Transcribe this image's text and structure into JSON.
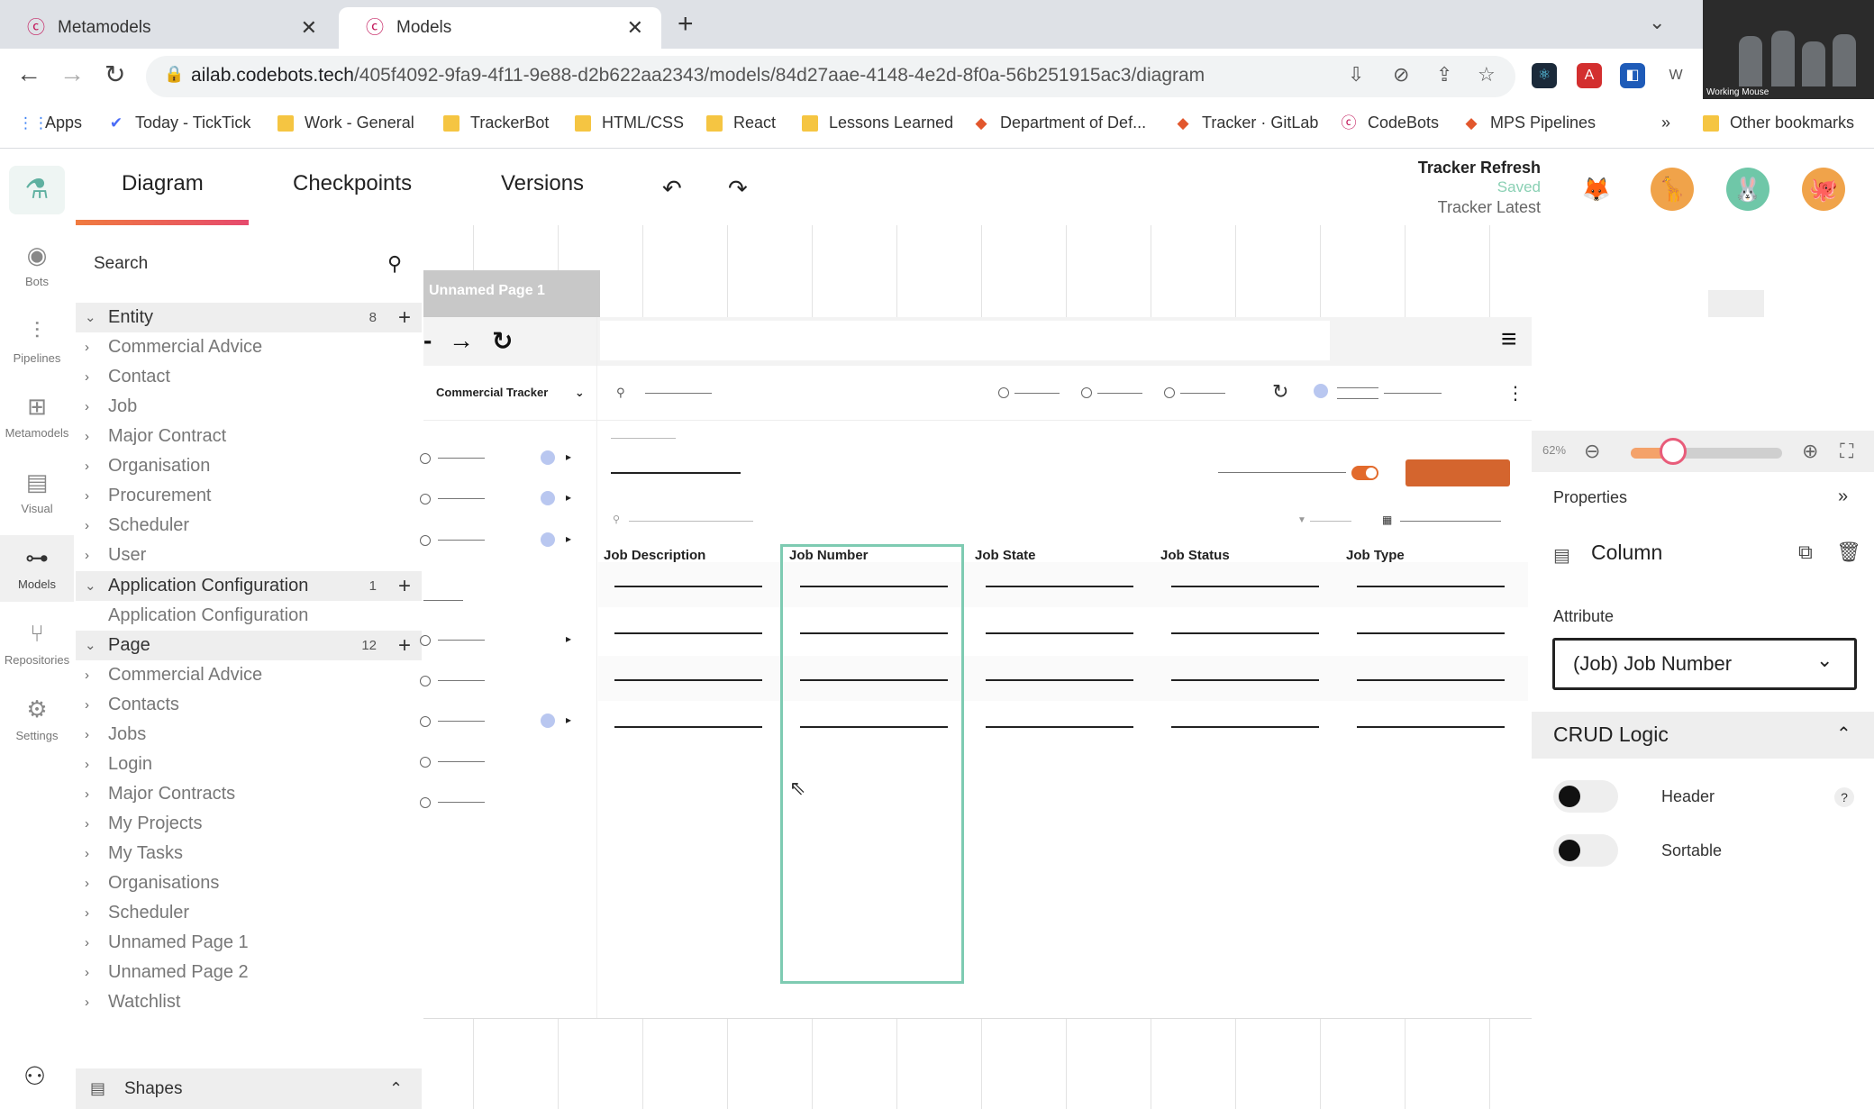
{
  "browser": {
    "tabs": [
      {
        "title": "Metamodels",
        "active": false
      },
      {
        "title": "Models",
        "active": true
      }
    ],
    "url_host": "ailab.codebots.tech",
    "url_path": "/405f4092-9fa9-4f11-9e88-d2b622aa2343/models/84d27aae-4148-4e2d-8f0a-56b251915ac3/diagram",
    "bookmarks": [
      "Apps",
      "Today - TickTick",
      "Work - General",
      "TrackerBot",
      "HTML/CSS",
      "React",
      "Lessons Learned",
      "Department of Def...",
      "Tracker · GitLab",
      "CodeBots",
      "MPS Pipelines"
    ],
    "other_bookmarks": "Other bookmarks",
    "video_label": "Working Mouse"
  },
  "rail": {
    "items": [
      {
        "label": "Bots",
        "icon": "bot-icon"
      },
      {
        "label": "Pipelines",
        "icon": "pipeline-icon"
      },
      {
        "label": "Metamodels",
        "icon": "metamodel-icon"
      },
      {
        "label": "Visual",
        "icon": "visual-icon"
      },
      {
        "label": "Models",
        "icon": "models-icon",
        "selected": true
      },
      {
        "label": "Repositories",
        "icon": "repository-icon"
      },
      {
        "label": "Settings",
        "icon": "settings-icon"
      }
    ]
  },
  "header": {
    "tabs": [
      "Diagram",
      "Checkpoints",
      "Versions"
    ],
    "active_tab": "Diagram",
    "project_name": "Tracker Refresh",
    "save_status": "Saved",
    "branch": "Tracker Latest",
    "accent_colors": {
      "saved": "#8ad0b4",
      "underline_start": "#f07b3f",
      "underline_end": "#e64a6d"
    }
  },
  "tree": {
    "search_placeholder": "Search",
    "groups": [
      {
        "label": "Entity",
        "count": "8",
        "items": [
          "Commercial Advice",
          "Contact",
          "Job",
          "Major Contract",
          "Organisation",
          "Procurement",
          "Scheduler",
          "User"
        ]
      },
      {
        "label": "Application Configuration",
        "count": "1",
        "items": [
          "Application Configuration"
        ]
      },
      {
        "label": "Page",
        "count": "12",
        "items": [
          "Commercial Advice",
          "Contacts",
          "Jobs",
          "Login",
          "Major Contracts",
          "My Projects",
          "My Tasks",
          "Organisations",
          "Scheduler",
          "Unnamed Page 1",
          "Unnamed Page 2",
          "Watchlist"
        ]
      }
    ],
    "shapes_label": "Shapes"
  },
  "canvas": {
    "page_tab": "Unnamed Page 1",
    "app_title": "Commercial Tracker",
    "columns": [
      "Job Description",
      "Job Number",
      "Job State",
      "Job Status",
      "Job Type"
    ],
    "selected_column": "Job Number"
  },
  "properties": {
    "zoom": "62%",
    "title": "Properties",
    "element_type": "Column",
    "attribute_label": "Attribute",
    "attribute_value": "(Job) Job Number",
    "crud_title": "CRUD Logic",
    "toggles": [
      {
        "label": "Header",
        "on": false
      },
      {
        "label": "Sortable",
        "on": false
      }
    ],
    "help": "?"
  }
}
